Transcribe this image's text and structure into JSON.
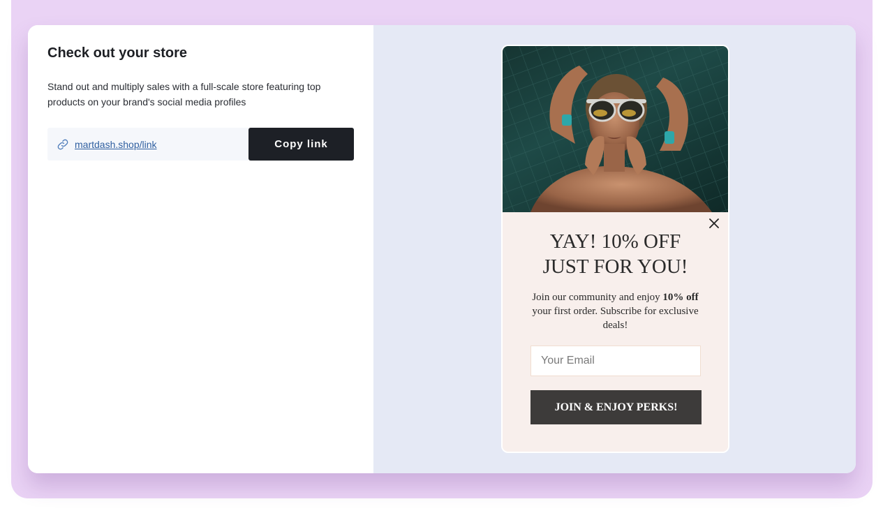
{
  "colors": {
    "frame": "#ead3f5",
    "card": "#ffffff",
    "preview_bg": "#e5e9f5",
    "primary_button": "#1d2026",
    "link": "#2f5fa0",
    "popup_bg": "#f8efec",
    "popup_button": "#3d3b3a"
  },
  "store": {
    "title": "Check out your store",
    "description": "Stand out and multiply sales with a full-scale store featuring top products on your brand's social media profiles",
    "link_icon": "link-icon",
    "link_text": "martdash.shop/link",
    "copy_button": "Copy link"
  },
  "popup": {
    "image": "woman-in-sunglasses-pool-photo",
    "close_icon": "close-icon",
    "heading_line1": "YAY! 10% OFF",
    "heading_line2": "JUST FOR YOU!",
    "text_before": "Join our community and enjoy",
    "text_bold": "10% off",
    "text_after": "your first order. Subscribe for exclusive deals!",
    "email_placeholder": "Your Email",
    "join_button": "JOIN & ENJOY PERKS!"
  }
}
